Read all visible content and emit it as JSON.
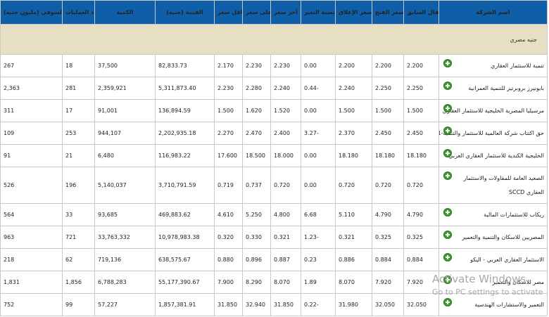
{
  "headers": {
    "market_cap": "راس المال السوقى (مليون جنيه)",
    "trades": "عدد العمليات",
    "volume": "الكمية",
    "value": "القيمة (جنيه)",
    "low": "اقل سعر",
    "high": "اعلى سعر",
    "last": "آخر سعر",
    "change": "نسبة التغير%",
    "close": "سعر الإغلاق",
    "open": "سعر الفتح",
    "prev_close": "الإقفال السابق",
    "company": "اسم الشركة"
  },
  "group_label": "جنيه مصري",
  "rows": [
    {
      "name": "تنمية للاستثمار العقاري",
      "prev": "2.200",
      "open": "2.200",
      "close": "2.200",
      "change": "0.00",
      "last": "2.230",
      "high": "2.230",
      "low": "2.170",
      "value": "82,833.73",
      "volume": "37,500",
      "trades": "18",
      "cap": "267"
    },
    {
      "name": "بايونيرز بروبرتيز للتنمية العمرانية",
      "prev": "2.250",
      "open": "2.250",
      "close": "2.240",
      "change": "0.44-",
      "last": "2.240",
      "high": "2.280",
      "low": "2.230",
      "value": "5,311,873.40",
      "volume": "2,359,921",
      "trades": "281",
      "cap": "2,363"
    },
    {
      "name": "مرسيليا المصرية الخليجية للاستثمار العقاري",
      "prev": "1.500",
      "open": "1.500",
      "close": "1.500",
      "change": "0.00",
      "last": "1.520",
      "high": "1.620",
      "low": "1.500",
      "value": "136,894.59",
      "volume": "91,001",
      "trades": "17",
      "cap": "311"
    },
    {
      "name": "حق اكتتاب شركة العالمية للاستثمار والتنميه-1",
      "prev": "2.450",
      "open": "2.450",
      "close": "2.370",
      "change": "3.27-",
      "last": "2.400",
      "high": "2.470",
      "low": "2.270",
      "value": "2,202,935.18",
      "volume": "944,107",
      "trades": "253",
      "cap": "109"
    },
    {
      "name": "الخليجية الكندية للاستثمار العقاري العربي",
      "prev": "18.180",
      "open": "18.180",
      "close": "18.180",
      "change": "0.00",
      "last": "18.000",
      "high": "18.500",
      "low": "17.600",
      "value": "116,983.22",
      "volume": "6,480",
      "trades": "21",
      "cap": "91"
    },
    {
      "name": "الصعيد العامة للمقاولات والاستثمار العقاري SCCD",
      "prev": "0.720",
      "open": "0.720",
      "close": "0.720",
      "change": "0.00",
      "last": "0.720",
      "high": "0.737",
      "low": "0.719",
      "value": "3,710,791.59",
      "volume": "5,140,037",
      "trades": "196",
      "cap": "526"
    },
    {
      "name": "ريكاب للاستثمارات المالية",
      "prev": "4.790",
      "open": "4.790",
      "close": "5.110",
      "change": "6.68",
      "last": "4.800",
      "high": "5.250",
      "low": "4.610",
      "value": "469,883.62",
      "volume": "93,685",
      "trades": "33",
      "cap": "564"
    },
    {
      "name": "المصريين للاسكان والتنمية والتعمير",
      "prev": "0.325",
      "open": "0.325",
      "close": "0.321",
      "change": "1.23-",
      "last": "0.321",
      "high": "0.330",
      "low": "0.320",
      "value": "10,978,983.38",
      "volume": "33,763,332",
      "trades": "721",
      "cap": "963"
    },
    {
      "name": "الاستثمار العقاري العربي - اليكو",
      "prev": "0.884",
      "open": "0.884",
      "close": "0.886",
      "change": "0.23",
      "last": "0.887",
      "high": "0.896",
      "low": "0.880",
      "value": "638,575.67",
      "volume": "719,136",
      "trades": "62",
      "cap": "218"
    },
    {
      "name": "مصر للاسكان والتعمير",
      "prev": "7.920",
      "open": "7.920",
      "close": "8.070",
      "change": "1.89",
      "last": "8.070",
      "high": "8.290",
      "low": "7.900",
      "value": "55,177,390.67",
      "volume": "6,788,283",
      "trades": "1,856",
      "cap": "1,831"
    },
    {
      "name": "التعمير والاستشارات الهندسية",
      "prev": "32.050",
      "open": "32.050",
      "close": "31.980",
      "change": "0.22-",
      "last": "31.850",
      "high": "32.940",
      "low": "31.850",
      "value": "1,857,381.91",
      "volume": "57,227",
      "trades": "99",
      "cap": "752"
    }
  ],
  "watermark": {
    "line1": "Activate Windows",
    "line2": "Go to PC settings to activate"
  }
}
